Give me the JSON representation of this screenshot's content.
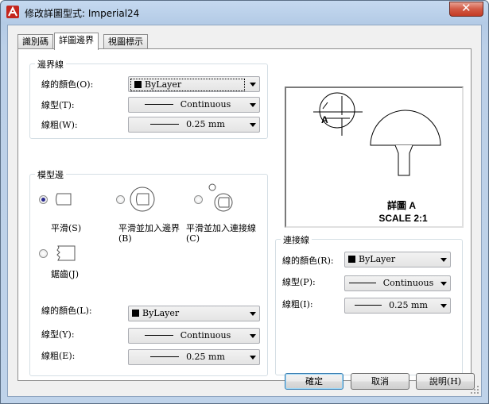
{
  "window": {
    "title": "修改詳圖型式: Imperial24"
  },
  "tabs": [
    {
      "label": "識別碼",
      "active": false
    },
    {
      "label": "詳圖邊界",
      "active": true
    },
    {
      "label": "視圖標示",
      "active": false
    }
  ],
  "boundary": {
    "title": "邊界線",
    "color_label": "線的顏色(O):",
    "color_value": "ByLayer",
    "linetype_label": "線型(T):",
    "linetype_value": "Continuous",
    "lineweight_label": "線粗(W):",
    "lineweight_value": "0.25 mm"
  },
  "model_edge": {
    "title": "模型邊",
    "options": [
      {
        "label": "平滑(S)",
        "selected": true
      },
      {
        "label": "平滑並加入邊界(B)",
        "selected": false
      },
      {
        "label": "平滑並加入連接線(C)",
        "selected": false
      },
      {
        "label": "鋸齒(J)",
        "selected": false
      }
    ],
    "color_label": "線的顏色(L):",
    "color_value": "ByLayer",
    "linetype_label": "線型(Y):",
    "linetype_value": "Continuous",
    "lineweight_label": "線粗(E):",
    "lineweight_value": "0.25 mm"
  },
  "preview": {
    "detail_text": "詳圖 A",
    "scale_text": "SCALE 2:1",
    "marker_letter": "A"
  },
  "connection": {
    "title": "連接線",
    "color_label": "線的顏色(R):",
    "color_value": "ByLayer",
    "linetype_label": "線型(P):",
    "linetype_value": "Continuous",
    "lineweight_label": "線粗(I):",
    "lineweight_value": "0.25 mm"
  },
  "buttons": {
    "ok": "確定",
    "cancel": "取消",
    "help": "說明(H)"
  },
  "colors": {
    "title_gradient": "#bcd0e8",
    "close_button": "#c43b25",
    "radio_dot": "#2b2b8f"
  }
}
